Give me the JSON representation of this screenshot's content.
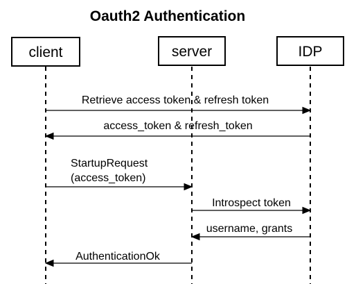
{
  "title": "Oauth2 Authentication",
  "actors": {
    "client": "client",
    "server": "server",
    "idp": "IDP"
  },
  "messages": [
    {
      "from": "client",
      "to": "idp",
      "lines": [
        "Retrieve access token & refresh token"
      ]
    },
    {
      "from": "idp",
      "to": "client",
      "lines": [
        "access_token & refresh_token"
      ]
    },
    {
      "from": "client",
      "to": "server",
      "lines": [
        "StartupRequest",
        "(access_token)"
      ]
    },
    {
      "from": "server",
      "to": "idp",
      "lines": [
        "Introspect token"
      ]
    },
    {
      "from": "idp",
      "to": "server",
      "lines": [
        "username, grants"
      ]
    },
    {
      "from": "server",
      "to": "client",
      "lines": [
        "AuthenticationOk"
      ]
    }
  ]
}
